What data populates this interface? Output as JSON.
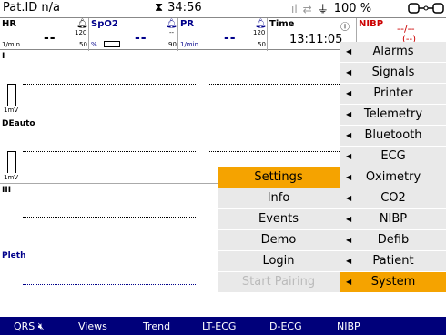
{
  "status": {
    "patient_id": "Pat.ID n/a",
    "timer": "34:56",
    "battery": "100 %"
  },
  "params": {
    "hr": {
      "label": "HR",
      "value": "--",
      "hi": "120",
      "lo": "50",
      "unit": "1/min"
    },
    "spo2": {
      "label": "SpO2",
      "value": "--",
      "hi": "--",
      "lo": "90",
      "unit": "%"
    },
    "pr": {
      "label": "PR",
      "value": "--",
      "hi": "120",
      "lo": "50",
      "unit": "1/min"
    },
    "time": {
      "label": "Time",
      "value": "13:11:05"
    },
    "nibp": {
      "label": "NIBP",
      "value": "--/--",
      "sub": "(--)"
    }
  },
  "waves": {
    "w1": {
      "label": "I",
      "mv": "1mV"
    },
    "w2": {
      "label": "DEauto",
      "mv": "1mV"
    },
    "w3": {
      "label": "III"
    },
    "w4": {
      "label": "Pleth"
    }
  },
  "menu_right": [
    {
      "label": "Alarms"
    },
    {
      "label": "Signals"
    },
    {
      "label": "Printer"
    },
    {
      "label": "Telemetry"
    },
    {
      "label": "Bluetooth"
    },
    {
      "label": "ECG"
    },
    {
      "label": "Oximetry"
    },
    {
      "label": "CO2"
    },
    {
      "label": "NIBP"
    },
    {
      "label": "Defib"
    },
    {
      "label": "Patient"
    },
    {
      "label": "System"
    }
  ],
  "menu_left": [
    {
      "label": "Settings"
    },
    {
      "label": "Info"
    },
    {
      "label": "Events"
    },
    {
      "label": "Demo"
    },
    {
      "label": "Login"
    },
    {
      "label": "Start Pairing"
    }
  ],
  "bottom": {
    "qrs": "QRS",
    "views": "Views",
    "trend": "Trend",
    "lt_ecg": "LT-ECG",
    "d_ecg": "D-ECG",
    "nibp": "NIBP"
  },
  "colors": {
    "accent": "#f5a300",
    "menu_bg": "#e9e9e9",
    "bottom_bar": "#00007a",
    "spo2": "#00008b",
    "nibp": "#cc0000"
  }
}
